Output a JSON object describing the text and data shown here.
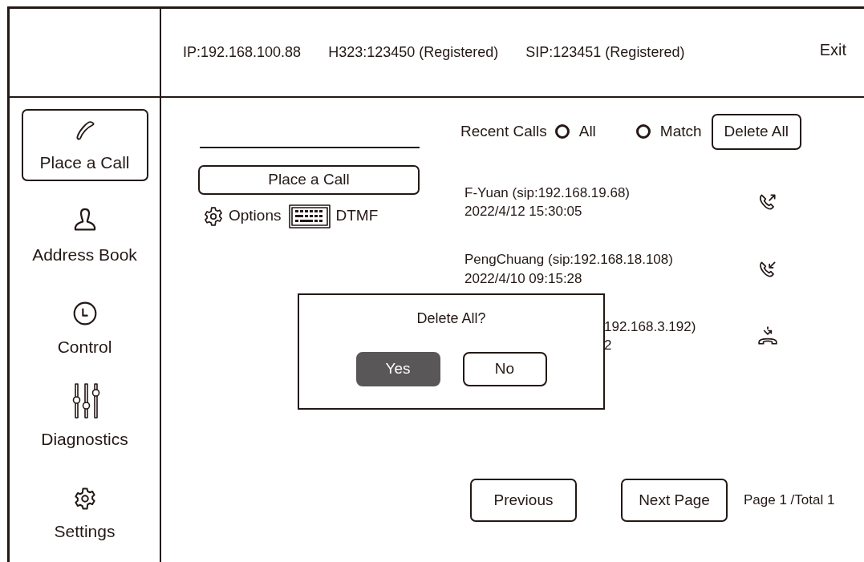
{
  "header": {
    "items": [
      "IP:192.168.100.88",
      "H323:123450 (Registered)",
      "SIP:123451 (Registered)"
    ],
    "exit": "Exit"
  },
  "sidebar": {
    "items": [
      {
        "label": "Place a Call",
        "kind": "call",
        "selected": true
      },
      {
        "label": "Address Book",
        "kind": "contacts",
        "selected": false
      },
      {
        "label": "Control",
        "kind": "clock",
        "selected": false
      },
      {
        "label": "Diagnostics",
        "kind": "sliders",
        "selected": false
      },
      {
        "label": "Settings",
        "kind": "gear",
        "selected": false
      }
    ]
  },
  "dialer": {
    "place_call": "Place a Call",
    "options": "Options",
    "dtmf": "DTMF"
  },
  "recent_calls": {
    "label": "Recent Calls",
    "filters": [
      {
        "label": "All",
        "selected": false
      },
      {
        "label": "Match",
        "selected": false
      }
    ],
    "delete_all": "Delete All",
    "calls": [
      {
        "name": "F-Yuan (sip:192.168.19.68)",
        "time": "2022/4/12 15:30:05",
        "kind": "outgoing",
        "partly_covered": false
      },
      {
        "name": "PengChuang (sip:192.168.18.108)",
        "time": "2022/4/10 09:15:28",
        "kind": "incoming",
        "partly_covered": false
      },
      {
        "name": "192.168.3.192)",
        "time": "2",
        "kind": "missed",
        "partly_covered": true
      }
    ]
  },
  "pagination": {
    "previous": "Previous",
    "next": "Next Page",
    "page_info": "Page 1 /Total 1"
  },
  "dialog": {
    "title": "Delete All?",
    "buttons": [
      {
        "label": "Yes",
        "selected": true
      },
      {
        "label": "No",
        "selected": false
      }
    ]
  }
}
